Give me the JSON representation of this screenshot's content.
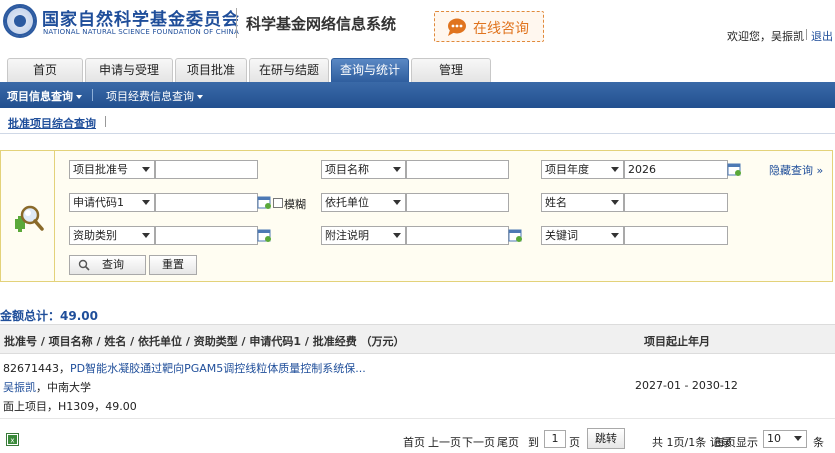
{
  "header": {
    "org_name_cn": "国家自然科学基金委员会",
    "org_name_en": "NATIONAL NATURAL SCIENCE FOUNDATION OF CHINA",
    "system_name": "科学基金网络信息系统",
    "consult_label": "在线咨询",
    "welcome": "欢迎您，吴振凯",
    "logout": "退出"
  },
  "tabs": [
    {
      "label": "首页"
    },
    {
      "label": "申请与受理"
    },
    {
      "label": "项目批准"
    },
    {
      "label": "在研与结题"
    },
    {
      "label": "查询与统计"
    },
    {
      "label": "管理"
    }
  ],
  "menu": {
    "item1": "项目信息查询",
    "item2": "项目经费信息查询"
  },
  "subnav": {
    "link": "批准项目综合查询"
  },
  "search": {
    "row1": {
      "field1_select": "项目批准号",
      "field1_value": "",
      "field2_select": "项目名称",
      "field2_value": "",
      "field3_select": "项目年度",
      "field3_value": "2026"
    },
    "row2": {
      "field1_select": "申请代码1",
      "field1_value": "",
      "fuzzy_label": "模糊",
      "field2_select": "依托单位",
      "field2_value": "",
      "field3_select": "姓名",
      "field3_value": ""
    },
    "row3": {
      "field1_select": "资助类别",
      "field1_value": "",
      "field2_select": "附注说明",
      "field2_value": "",
      "field3_select": "关键词",
      "field3_value": ""
    },
    "hide_link": "隐藏查询 »",
    "query_button": "查询",
    "reset_button": "重置"
  },
  "results": {
    "total_label": "金额总计：49.00",
    "header_main": "批准号 / 项目名称 / 姓名 / 依托单位 / 资助类型 / 申请代码1 / 批准经费 （万元）",
    "header_date": "项目起止年月",
    "rows": [
      {
        "number": "82671443，",
        "title": "PD智能水凝胶通过靶向PGAM5调控线粒体质量控制系统保...",
        "person": "吴振凯",
        "org": "，中南大学",
        "line3": "面上项目，H1309，49.00",
        "date": "2027-01 - 2030-12"
      }
    ]
  },
  "pager": {
    "first": "首页",
    "prev": "上一页",
    "next": "下一页",
    "last": "尾页",
    "to_label": "到",
    "page_value": "1",
    "page_unit": "页",
    "jump_button": "跳转",
    "summary": "共 1页/1条 记录",
    "per_page_label": "每页显示",
    "per_page_value": "10",
    "per_page_unit": "条"
  },
  "colors": {
    "brand_blue": "#1f4e9a",
    "menu_blue": "#22508f",
    "consult_orange": "#e0741f",
    "panel_border": "#e3d27a"
  }
}
